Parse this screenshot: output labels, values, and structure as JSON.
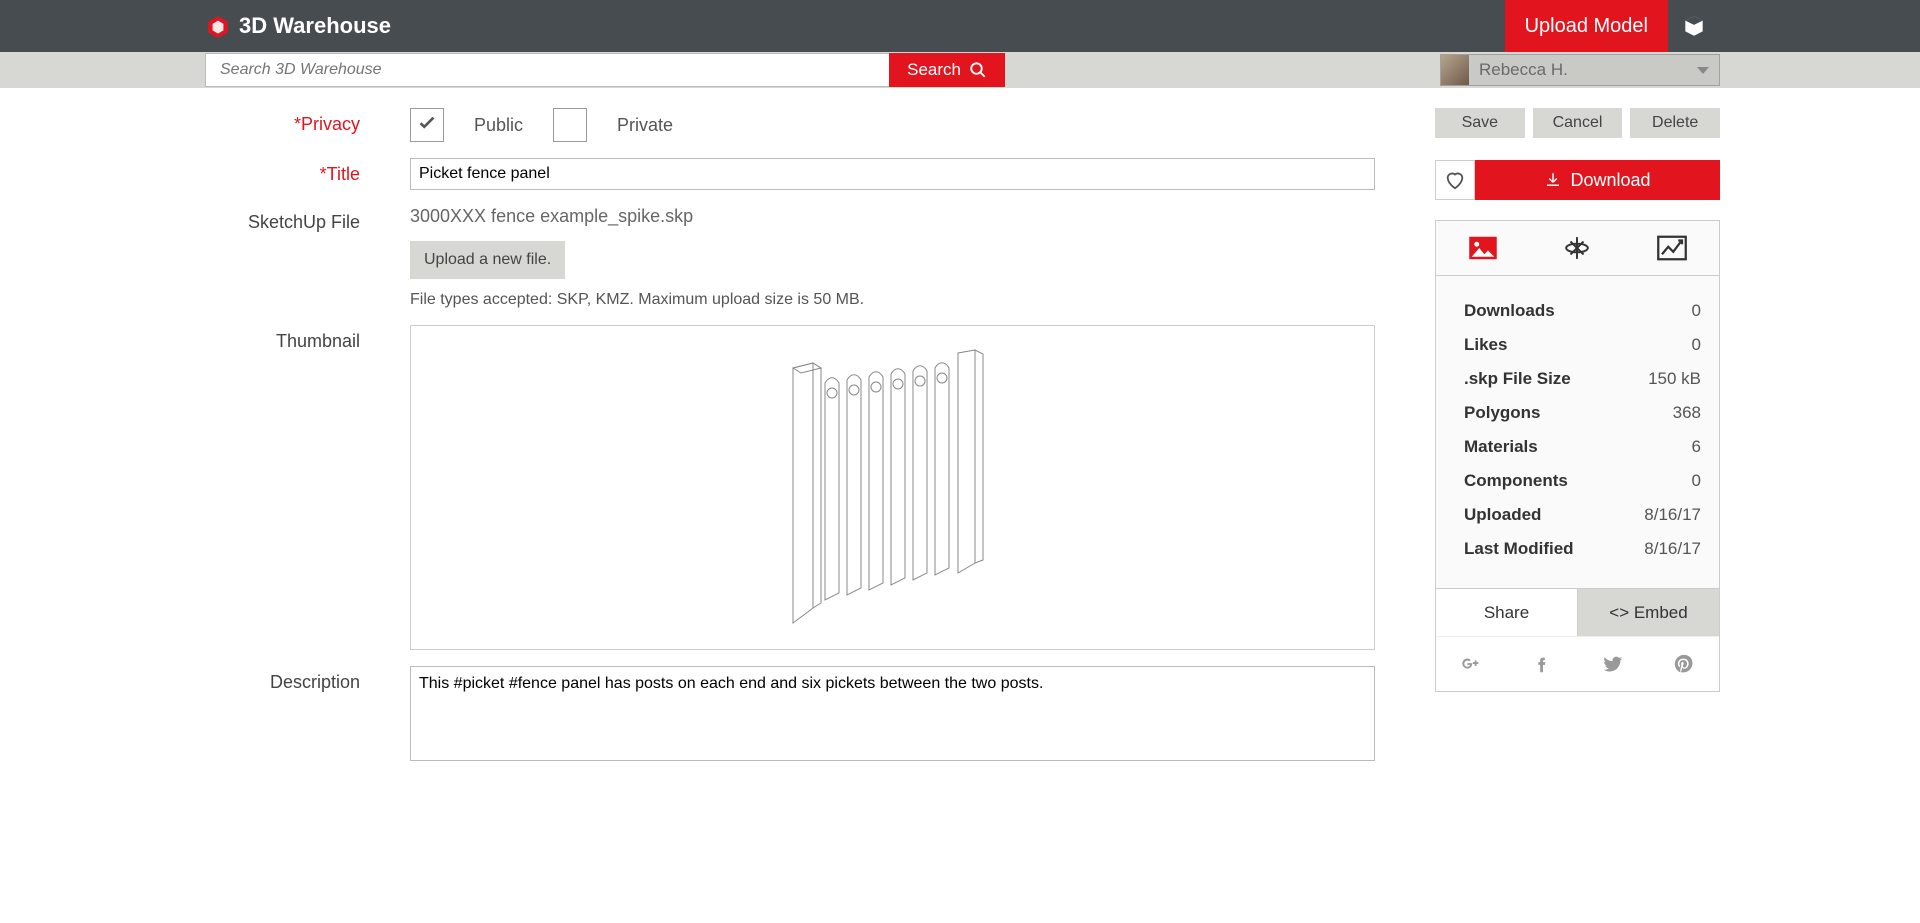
{
  "header": {
    "brand": "3D Warehouse",
    "upload_model": "Upload Model"
  },
  "search": {
    "placeholder": "Search 3D Warehouse",
    "button": "Search"
  },
  "user": {
    "name": "Rebecca H."
  },
  "form": {
    "privacy_label": "*Privacy",
    "public": "Public",
    "private": "Private",
    "title_label": "*Title",
    "title_value": "Picket fence panel",
    "sketchup_file_label": "SketchUp File",
    "filename": "3000XXX fence example_spike.skp",
    "upload_new": "Upload a new file.",
    "file_hint": "File types accepted: SKP, KMZ. Maximum upload size is 50 MB.",
    "thumbnail_label": "Thumbnail",
    "description_label": "Description",
    "description_value": "This #picket #fence panel has posts on each end and six pickets between the two posts."
  },
  "actions": {
    "save": "Save",
    "cancel": "Cancel",
    "delete": "Delete",
    "download": "Download"
  },
  "stats": [
    {
      "label": "Downloads",
      "value": "0"
    },
    {
      "label": "Likes",
      "value": "0"
    },
    {
      "label": ".skp File Size",
      "value": "150 kB"
    },
    {
      "label": "Polygons",
      "value": "368"
    },
    {
      "label": "Materials",
      "value": "6"
    },
    {
      "label": "Components",
      "value": "0"
    },
    {
      "label": "Uploaded",
      "value": "8/16/17"
    },
    {
      "label": "Last Modified",
      "value": "8/16/17"
    }
  ],
  "share": {
    "share": "Share",
    "embed": "<> Embed"
  }
}
